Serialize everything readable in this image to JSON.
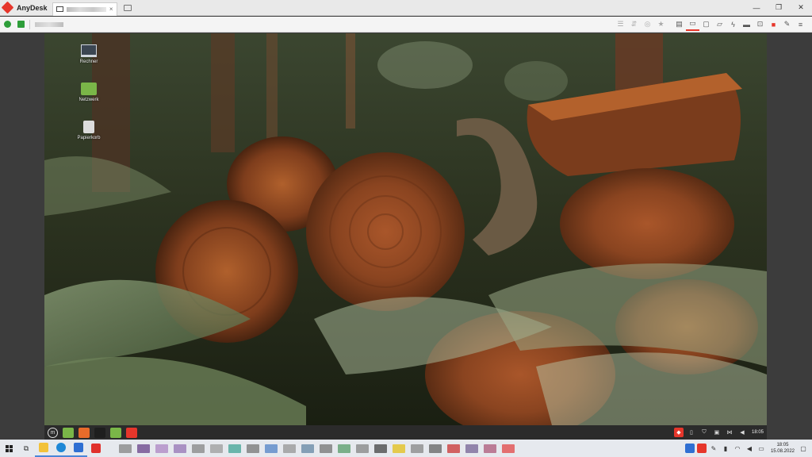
{
  "window": {
    "app_name": "AnyDesk",
    "tab_close": "×",
    "minimize": "—",
    "restore": "❐",
    "close": "✕"
  },
  "toolbar": {
    "icons": [
      {
        "name": "chat-icon",
        "glyph": "☰",
        "dim": true
      },
      {
        "name": "file-transfer-icon",
        "glyph": "⇵",
        "dim": true
      },
      {
        "name": "database-icon",
        "glyph": "◎",
        "dim": true
      },
      {
        "name": "favorite-star-icon",
        "glyph": "★",
        "dim": true
      },
      {
        "name": "document-icon",
        "glyph": "▤",
        "dim": false
      },
      {
        "name": "monitor-icon",
        "glyph": "▭",
        "dim": false,
        "active": true
      },
      {
        "name": "display-icon",
        "glyph": "▢",
        "dim": false
      },
      {
        "name": "message-icon",
        "glyph": "▱",
        "dim": false
      },
      {
        "name": "actions-lightning-icon",
        "glyph": "ϟ",
        "dim": false
      },
      {
        "name": "keyboard-icon",
        "glyph": "▬",
        "dim": false
      },
      {
        "name": "screenshot-icon",
        "glyph": "⊡",
        "dim": false
      },
      {
        "name": "record-icon",
        "glyph": "■",
        "dim": false,
        "red": true
      },
      {
        "name": "whiteboard-pen-icon",
        "glyph": "✎",
        "dim": false
      },
      {
        "name": "menu-icon",
        "glyph": "≡",
        "dim": false
      }
    ]
  },
  "desktop": {
    "icons": [
      {
        "label": "Rechner",
        "kind": "computer"
      },
      {
        "label": "Netzwerk",
        "kind": "folder"
      },
      {
        "label": "Papierkorb",
        "kind": "trash"
      }
    ]
  },
  "remote_panel": {
    "clock": "18:05",
    "apps": [
      {
        "name": "files-app",
        "color": "#7ab648"
      },
      {
        "name": "firefox-app",
        "color": "#e86b2a"
      },
      {
        "name": "terminal-app",
        "color": "#1e1e1e"
      },
      {
        "name": "folder-app",
        "color": "#7ab648"
      },
      {
        "name": "anydesk-app",
        "color": "#e6362b"
      }
    ]
  },
  "host_taskbar": {
    "time": "18:05",
    "date": "15.08.2022",
    "apps": [
      {
        "name": "explorer-app",
        "color": "#f2c23a"
      },
      {
        "name": "edge-app",
        "color": "#1f88d6"
      },
      {
        "name": "outlook-app",
        "color": "#2f6fd2"
      },
      {
        "name": "vivaldi-app",
        "color": "#e0302b"
      }
    ],
    "blurred": [
      "#8a8a8a",
      "#6f4b8e",
      "#b08bc6",
      "#9a7ab8",
      "#8b8b8b",
      "#a0a0a0",
      "#4aa89a",
      "#7c7c7c",
      "#5a88c8",
      "#9a9a9a",
      "#6c8ca8",
      "#7a7a7a",
      "#5fa06f",
      "#8a8a8a",
      "#4c4c4c",
      "#e4c224",
      "#8c8c8c",
      "#6a6a6a",
      "#cc3f3f",
      "#7c6a9a",
      "#b06080",
      "#e25050"
    ]
  }
}
